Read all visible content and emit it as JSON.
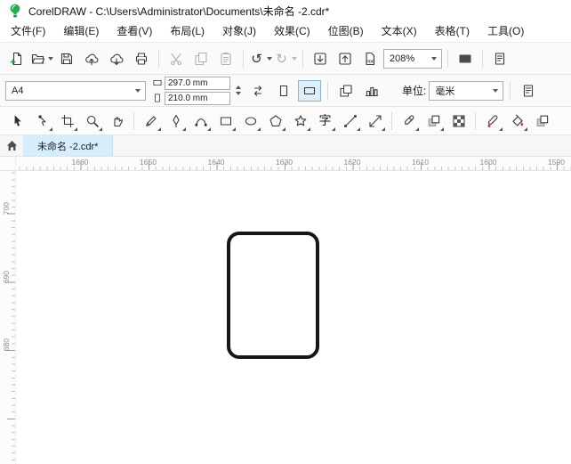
{
  "titlebar": {
    "title": "CorelDRAW - C:\\Users\\Administrator\\Documents\\未命名 -2.cdr*"
  },
  "menubar": {
    "items": [
      {
        "name": "menu-file",
        "label": "文件(F)"
      },
      {
        "name": "menu-edit",
        "label": "编辑(E)"
      },
      {
        "name": "menu-view",
        "label": "查看(V)"
      },
      {
        "name": "menu-layout",
        "label": "布局(L)"
      },
      {
        "name": "menu-object",
        "label": "对象(J)"
      },
      {
        "name": "menu-effects",
        "label": "效果(C)"
      },
      {
        "name": "menu-bitmaps",
        "label": "位图(B)"
      },
      {
        "name": "menu-text",
        "label": "文本(X)"
      },
      {
        "name": "menu-table",
        "label": "表格(T)"
      },
      {
        "name": "menu-tools",
        "label": "工具(O)"
      }
    ]
  },
  "toolbar": {
    "zoom_level": "208%",
    "items": [
      {
        "name": "new-document-button",
        "icon": "new"
      },
      {
        "name": "open-document-button",
        "icon": "open",
        "caret": true
      },
      {
        "name": "save-button",
        "icon": "save"
      },
      {
        "name": "cloud-open-button",
        "icon": "cloudopen"
      },
      {
        "name": "cloud-save-button",
        "icon": "cloudsave"
      },
      {
        "name": "print-button",
        "icon": "print"
      },
      {
        "sep": true
      },
      {
        "name": "cut-button",
        "icon": "cut",
        "disabled": true
      },
      {
        "name": "copy-button",
        "icon": "copy",
        "disabled": true
      },
      {
        "name": "paste-button",
        "icon": "clipboard",
        "disabled": true
      },
      {
        "sep": true
      },
      {
        "name": "undo-button",
        "icon": "undo",
        "caret": true
      },
      {
        "name": "redo-button",
        "icon": "redo",
        "caret": true,
        "disabled": true
      },
      {
        "sep": true
      },
      {
        "name": "import-button",
        "icon": "boxdown"
      },
      {
        "name": "export-button",
        "icon": "boxup"
      },
      {
        "name": "publish-pdf-button",
        "icon": "pdf"
      },
      {
        "zoombox": true,
        "name": "zoom-level-select"
      },
      {
        "sep": true
      },
      {
        "name": "fullscreen-preview-button",
        "icon": "fullscreen"
      },
      {
        "sep": true
      },
      {
        "name": "show-rulers-button",
        "icon": "docpage"
      }
    ]
  },
  "property_bar": {
    "page_size": "A4",
    "page_width": "297.0 mm",
    "page_height": "210.0 mm",
    "units_label": "单位:",
    "units_value": "毫米"
  },
  "toolbox": {
    "text_glyph": "字",
    "tools": [
      {
        "name": "pick-tool",
        "icon": "arrow"
      },
      {
        "name": "shape-tool",
        "icon": "nodearrow",
        "caret": true
      },
      {
        "name": "crop-tool",
        "icon": "crop",
        "caret": true
      },
      {
        "name": "zoom-tool",
        "icon": "zoom",
        "caret": true
      },
      {
        "name": "pan-tool",
        "icon": "hand"
      },
      {
        "sep": true
      },
      {
        "name": "freehand-tool",
        "icon": "pencil",
        "caret": true
      },
      {
        "name": "pen-tool",
        "icon": "pen",
        "caret": true
      },
      {
        "name": "bspline-tool",
        "icon": "curve",
        "caret": true
      },
      {
        "name": "rectangle-tool",
        "icon": "recttool",
        "caret": true
      },
      {
        "name": "ellipse-tool",
        "icon": "ellipsetool",
        "caret": true
      },
      {
        "name": "polygon-tool",
        "icon": "polygon",
        "caret": true
      },
      {
        "name": "common-shapes-tool",
        "icon": "star",
        "caret": true
      },
      {
        "name": "text-tool",
        "icon": "text",
        "caret": true
      },
      {
        "name": "two-point-line-tool",
        "icon": "linetool",
        "caret": true
      },
      {
        "name": "dimension-tool",
        "icon": "dimension",
        "caret": true
      },
      {
        "sep": true
      },
      {
        "name": "eyedropper-tool",
        "icon": "dropper",
        "caret": true
      },
      {
        "name": "drop-shadow-tool",
        "icon": "blend",
        "caret": true
      },
      {
        "name": "transparency-tool",
        "icon": "checker"
      },
      {
        "sep": true
      },
      {
        "name": "color-eyedropper-tool",
        "icon": "dropper2",
        "caret": true
      },
      {
        "name": "interactive-fill-tool",
        "icon": "bucket",
        "caret": true
      },
      {
        "name": "smart-fill-tool",
        "icon": "blend"
      }
    ]
  },
  "tabbar": {
    "active_tab": "未命名 -2.cdr*"
  },
  "rulers": {
    "horizontal": [
      "1660",
      "1650",
      "1640",
      "1630",
      "1620",
      "1610",
      "1600",
      "1590"
    ],
    "vertical": [
      "700",
      "690",
      "680"
    ]
  },
  "canvas": {
    "shape": "rounded-rectangle",
    "shape_stroke": "#161616",
    "background": "#ffffff"
  },
  "colors": {
    "tab_active": "#d6eefb",
    "logo_green": "#21b14c"
  }
}
